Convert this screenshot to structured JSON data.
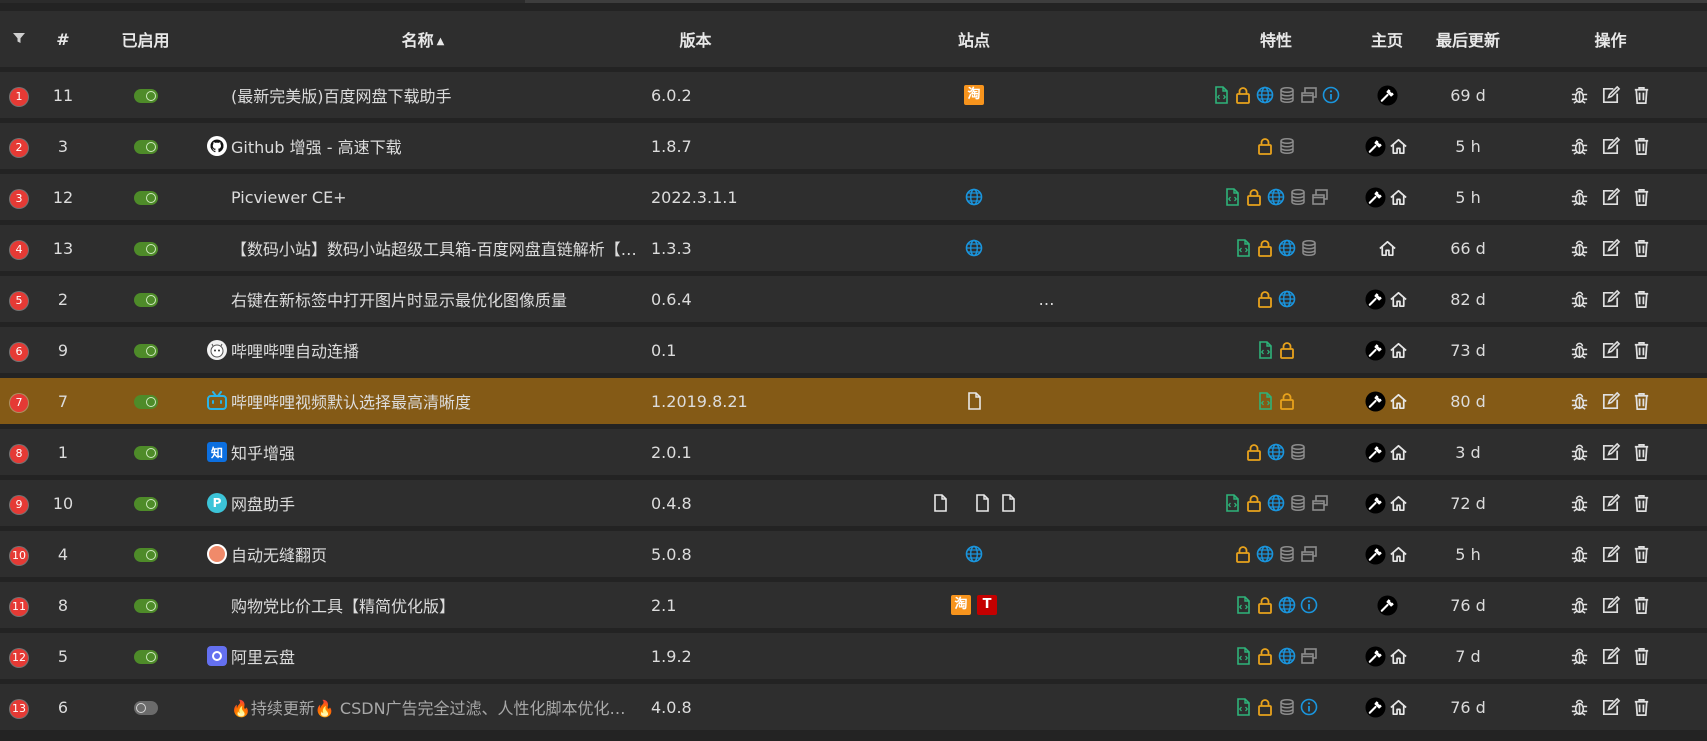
{
  "header": {
    "index": "#",
    "enabled": "已启用",
    "name": "名称",
    "version": "版本",
    "sites": "站点",
    "features": "特性",
    "homepage": "主页",
    "updated": "最后更新",
    "actions": "操作",
    "sort_arrow": "▲"
  },
  "colors": {
    "accent_highlight": "#845a16",
    "badge_red": "#e53a35",
    "toggle_on": "#4e8b29",
    "icon_green": "#2eb37a",
    "icon_orange": "#e8a21c",
    "icon_blue": "#1a95dd",
    "icon_gray": "#8c8c8c"
  },
  "rows": [
    {
      "badge": "1",
      "num": "11",
      "enabled": true,
      "icon": "none",
      "name": "(最新完美版)百度网盘下载助手",
      "version": "6.0.2",
      "sites": [
        "taobao"
      ],
      "features": [
        "script",
        "lock",
        "globe",
        "db",
        "windows",
        "info"
      ],
      "home": [
        "wrench"
      ],
      "updated": "69 d",
      "highlight": false
    },
    {
      "badge": "2",
      "num": "3",
      "enabled": true,
      "icon": "github",
      "name": "Github 增强 - 高速下载",
      "version": "1.8.7",
      "sites": [],
      "features": [
        "lock",
        "db"
      ],
      "home": [
        "wrench",
        "house"
      ],
      "updated": "5 h",
      "highlight": false
    },
    {
      "badge": "3",
      "num": "12",
      "enabled": true,
      "icon": "none",
      "name": "Picviewer CE+",
      "version": "2022.3.1.1",
      "sites": [
        "globe"
      ],
      "features": [
        "script",
        "lock",
        "globe",
        "db",
        "windows"
      ],
      "home": [
        "wrench",
        "house"
      ],
      "updated": "5 h",
      "highlight": false
    },
    {
      "badge": "4",
      "num": "13",
      "enabled": true,
      "icon": "none",
      "name": "【数码小站】数码小站超级工具箱-百度网盘直链解析【…",
      "version": "1.3.3",
      "sites": [
        "globe"
      ],
      "features": [
        "script",
        "lock",
        "globe",
        "db"
      ],
      "home": [
        "house"
      ],
      "updated": "66 d",
      "highlight": false
    },
    {
      "badge": "5",
      "num": "2",
      "enabled": true,
      "icon": "none",
      "name": "右键在新标签中打开图片时显示最优化图像质量",
      "version": "0.6.4",
      "sites": [
        "ellipsis"
      ],
      "features": [
        "lock",
        "globe"
      ],
      "home": [
        "wrench",
        "house"
      ],
      "updated": "82 d",
      "highlight": false
    },
    {
      "badge": "6",
      "num": "9",
      "enabled": true,
      "icon": "bili-face",
      "name": "哔哩哔哩自动连播",
      "version": "0.1",
      "sites": [],
      "features": [
        "script",
        "lock"
      ],
      "home": [
        "wrench",
        "house"
      ],
      "updated": "73 d",
      "highlight": false
    },
    {
      "badge": "7",
      "num": "7",
      "enabled": true,
      "icon": "bilibili-tv",
      "name": "哔哩哔哩视频默认选择最高清晰度",
      "version": "1.2019.8.21",
      "sites": [
        "page"
      ],
      "features": [
        "script",
        "lock"
      ],
      "home": [
        "wrench",
        "house"
      ],
      "updated": "80 d",
      "highlight": true
    },
    {
      "badge": "8",
      "num": "1",
      "enabled": true,
      "icon": "zhihu",
      "name": "知乎增强",
      "version": "2.0.1",
      "sites": [],
      "features": [
        "lock",
        "globe",
        "db"
      ],
      "home": [
        "wrench",
        "house"
      ],
      "updated": "3 d",
      "highlight": false
    },
    {
      "badge": "9",
      "num": "10",
      "enabled": true,
      "icon": "pan-p",
      "name": "网盘助手",
      "version": "0.4.8",
      "sites": [
        "page",
        "gap",
        "page",
        "page"
      ],
      "features": [
        "script",
        "lock",
        "globe",
        "db",
        "windows"
      ],
      "home": [
        "wrench",
        "house"
      ],
      "updated": "72 d",
      "highlight": false
    },
    {
      "badge": "10",
      "num": "4",
      "enabled": true,
      "icon": "pagetual",
      "name": "自动无缝翻页",
      "version": "5.0.8",
      "sites": [
        "globe"
      ],
      "features": [
        "lock",
        "globe",
        "db",
        "windows"
      ],
      "home": [
        "wrench",
        "house"
      ],
      "updated": "5 h",
      "highlight": false
    },
    {
      "badge": "11",
      "num": "8",
      "enabled": true,
      "icon": "none",
      "name": "购物党比价工具【精简优化版】",
      "version": "2.1",
      "sites": [
        "taobao",
        "tmall"
      ],
      "features": [
        "script",
        "lock",
        "globe",
        "info"
      ],
      "home": [
        "wrench"
      ],
      "updated": "76 d",
      "highlight": false
    },
    {
      "badge": "12",
      "num": "5",
      "enabled": true,
      "icon": "aliyun",
      "name": "阿里云盘",
      "version": "1.9.2",
      "sites": [],
      "features": [
        "script",
        "lock",
        "globe",
        "windows"
      ],
      "home": [
        "wrench",
        "house"
      ],
      "updated": "7 d",
      "highlight": false
    },
    {
      "badge": "13",
      "num": "6",
      "enabled": false,
      "icon": "none",
      "name": "🔥持续更新🔥 CSDN广告完全过滤、人性化脚本优化…",
      "version": "4.0.8",
      "sites": [],
      "features": [
        "script",
        "lock",
        "db",
        "info"
      ],
      "home": [
        "wrench",
        "house"
      ],
      "updated": "76 d",
      "highlight": false
    }
  ]
}
